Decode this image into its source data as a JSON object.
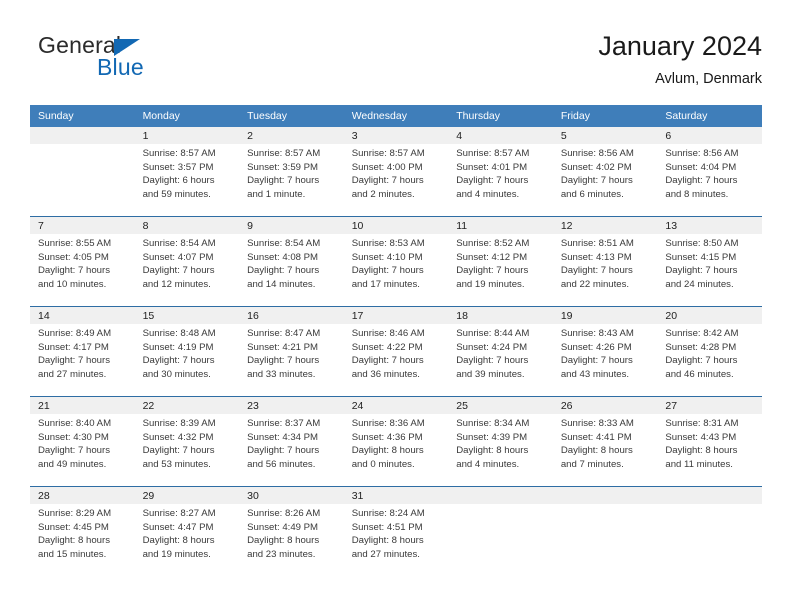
{
  "brand": {
    "word_one": "General",
    "word_two": "Blue",
    "triangle_icon": "triangle-icon"
  },
  "header": {
    "title": "January 2024",
    "location": "Avlum, Denmark"
  },
  "calendar": {
    "weekday_headers": [
      "Sunday",
      "Monday",
      "Tuesday",
      "Wednesday",
      "Thursday",
      "Friday",
      "Saturday"
    ],
    "accent_color": "#3f7eba",
    "separator_color": "#2e6da4",
    "daynum_band_color": "#f0f0f0",
    "weeks": [
      [
        {
          "day": "",
          "sunrise": "",
          "sunset": "",
          "daylight_line1": "",
          "daylight_line2": ""
        },
        {
          "day": "1",
          "sunrise": "Sunrise: 8:57 AM",
          "sunset": "Sunset: 3:57 PM",
          "daylight_line1": "Daylight: 6 hours",
          "daylight_line2": "and 59 minutes."
        },
        {
          "day": "2",
          "sunrise": "Sunrise: 8:57 AM",
          "sunset": "Sunset: 3:59 PM",
          "daylight_line1": "Daylight: 7 hours",
          "daylight_line2": "and 1 minute."
        },
        {
          "day": "3",
          "sunrise": "Sunrise: 8:57 AM",
          "sunset": "Sunset: 4:00 PM",
          "daylight_line1": "Daylight: 7 hours",
          "daylight_line2": "and 2 minutes."
        },
        {
          "day": "4",
          "sunrise": "Sunrise: 8:57 AM",
          "sunset": "Sunset: 4:01 PM",
          "daylight_line1": "Daylight: 7 hours",
          "daylight_line2": "and 4 minutes."
        },
        {
          "day": "5",
          "sunrise": "Sunrise: 8:56 AM",
          "sunset": "Sunset: 4:02 PM",
          "daylight_line1": "Daylight: 7 hours",
          "daylight_line2": "and 6 minutes."
        },
        {
          "day": "6",
          "sunrise": "Sunrise: 8:56 AM",
          "sunset": "Sunset: 4:04 PM",
          "daylight_line1": "Daylight: 7 hours",
          "daylight_line2": "and 8 minutes."
        }
      ],
      [
        {
          "day": "7",
          "sunrise": "Sunrise: 8:55 AM",
          "sunset": "Sunset: 4:05 PM",
          "daylight_line1": "Daylight: 7 hours",
          "daylight_line2": "and 10 minutes."
        },
        {
          "day": "8",
          "sunrise": "Sunrise: 8:54 AM",
          "sunset": "Sunset: 4:07 PM",
          "daylight_line1": "Daylight: 7 hours",
          "daylight_line2": "and 12 minutes."
        },
        {
          "day": "9",
          "sunrise": "Sunrise: 8:54 AM",
          "sunset": "Sunset: 4:08 PM",
          "daylight_line1": "Daylight: 7 hours",
          "daylight_line2": "and 14 minutes."
        },
        {
          "day": "10",
          "sunrise": "Sunrise: 8:53 AM",
          "sunset": "Sunset: 4:10 PM",
          "daylight_line1": "Daylight: 7 hours",
          "daylight_line2": "and 17 minutes."
        },
        {
          "day": "11",
          "sunrise": "Sunrise: 8:52 AM",
          "sunset": "Sunset: 4:12 PM",
          "daylight_line1": "Daylight: 7 hours",
          "daylight_line2": "and 19 minutes."
        },
        {
          "day": "12",
          "sunrise": "Sunrise: 8:51 AM",
          "sunset": "Sunset: 4:13 PM",
          "daylight_line1": "Daylight: 7 hours",
          "daylight_line2": "and 22 minutes."
        },
        {
          "day": "13",
          "sunrise": "Sunrise: 8:50 AM",
          "sunset": "Sunset: 4:15 PM",
          "daylight_line1": "Daylight: 7 hours",
          "daylight_line2": "and 24 minutes."
        }
      ],
      [
        {
          "day": "14",
          "sunrise": "Sunrise: 8:49 AM",
          "sunset": "Sunset: 4:17 PM",
          "daylight_line1": "Daylight: 7 hours",
          "daylight_line2": "and 27 minutes."
        },
        {
          "day": "15",
          "sunrise": "Sunrise: 8:48 AM",
          "sunset": "Sunset: 4:19 PM",
          "daylight_line1": "Daylight: 7 hours",
          "daylight_line2": "and 30 minutes."
        },
        {
          "day": "16",
          "sunrise": "Sunrise: 8:47 AM",
          "sunset": "Sunset: 4:21 PM",
          "daylight_line1": "Daylight: 7 hours",
          "daylight_line2": "and 33 minutes."
        },
        {
          "day": "17",
          "sunrise": "Sunrise: 8:46 AM",
          "sunset": "Sunset: 4:22 PM",
          "daylight_line1": "Daylight: 7 hours",
          "daylight_line2": "and 36 minutes."
        },
        {
          "day": "18",
          "sunrise": "Sunrise: 8:44 AM",
          "sunset": "Sunset: 4:24 PM",
          "daylight_line1": "Daylight: 7 hours",
          "daylight_line2": "and 39 minutes."
        },
        {
          "day": "19",
          "sunrise": "Sunrise: 8:43 AM",
          "sunset": "Sunset: 4:26 PM",
          "daylight_line1": "Daylight: 7 hours",
          "daylight_line2": "and 43 minutes."
        },
        {
          "day": "20",
          "sunrise": "Sunrise: 8:42 AM",
          "sunset": "Sunset: 4:28 PM",
          "daylight_line1": "Daylight: 7 hours",
          "daylight_line2": "and 46 minutes."
        }
      ],
      [
        {
          "day": "21",
          "sunrise": "Sunrise: 8:40 AM",
          "sunset": "Sunset: 4:30 PM",
          "daylight_line1": "Daylight: 7 hours",
          "daylight_line2": "and 49 minutes."
        },
        {
          "day": "22",
          "sunrise": "Sunrise: 8:39 AM",
          "sunset": "Sunset: 4:32 PM",
          "daylight_line1": "Daylight: 7 hours",
          "daylight_line2": "and 53 minutes."
        },
        {
          "day": "23",
          "sunrise": "Sunrise: 8:37 AM",
          "sunset": "Sunset: 4:34 PM",
          "daylight_line1": "Daylight: 7 hours",
          "daylight_line2": "and 56 minutes."
        },
        {
          "day": "24",
          "sunrise": "Sunrise: 8:36 AM",
          "sunset": "Sunset: 4:36 PM",
          "daylight_line1": "Daylight: 8 hours",
          "daylight_line2": "and 0 minutes."
        },
        {
          "day": "25",
          "sunrise": "Sunrise: 8:34 AM",
          "sunset": "Sunset: 4:39 PM",
          "daylight_line1": "Daylight: 8 hours",
          "daylight_line2": "and 4 minutes."
        },
        {
          "day": "26",
          "sunrise": "Sunrise: 8:33 AM",
          "sunset": "Sunset: 4:41 PM",
          "daylight_line1": "Daylight: 8 hours",
          "daylight_line2": "and 7 minutes."
        },
        {
          "day": "27",
          "sunrise": "Sunrise: 8:31 AM",
          "sunset": "Sunset: 4:43 PM",
          "daylight_line1": "Daylight: 8 hours",
          "daylight_line2": "and 11 minutes."
        }
      ],
      [
        {
          "day": "28",
          "sunrise": "Sunrise: 8:29 AM",
          "sunset": "Sunset: 4:45 PM",
          "daylight_line1": "Daylight: 8 hours",
          "daylight_line2": "and 15 minutes."
        },
        {
          "day": "29",
          "sunrise": "Sunrise: 8:27 AM",
          "sunset": "Sunset: 4:47 PM",
          "daylight_line1": "Daylight: 8 hours",
          "daylight_line2": "and 19 minutes."
        },
        {
          "day": "30",
          "sunrise": "Sunrise: 8:26 AM",
          "sunset": "Sunset: 4:49 PM",
          "daylight_line1": "Daylight: 8 hours",
          "daylight_line2": "and 23 minutes."
        },
        {
          "day": "31",
          "sunrise": "Sunrise: 8:24 AM",
          "sunset": "Sunset: 4:51 PM",
          "daylight_line1": "Daylight: 8 hours",
          "daylight_line2": "and 27 minutes."
        },
        {
          "day": "",
          "sunrise": "",
          "sunset": "",
          "daylight_line1": "",
          "daylight_line2": ""
        },
        {
          "day": "",
          "sunrise": "",
          "sunset": "",
          "daylight_line1": "",
          "daylight_line2": ""
        },
        {
          "day": "",
          "sunrise": "",
          "sunset": "",
          "daylight_line1": "",
          "daylight_line2": ""
        }
      ]
    ]
  }
}
